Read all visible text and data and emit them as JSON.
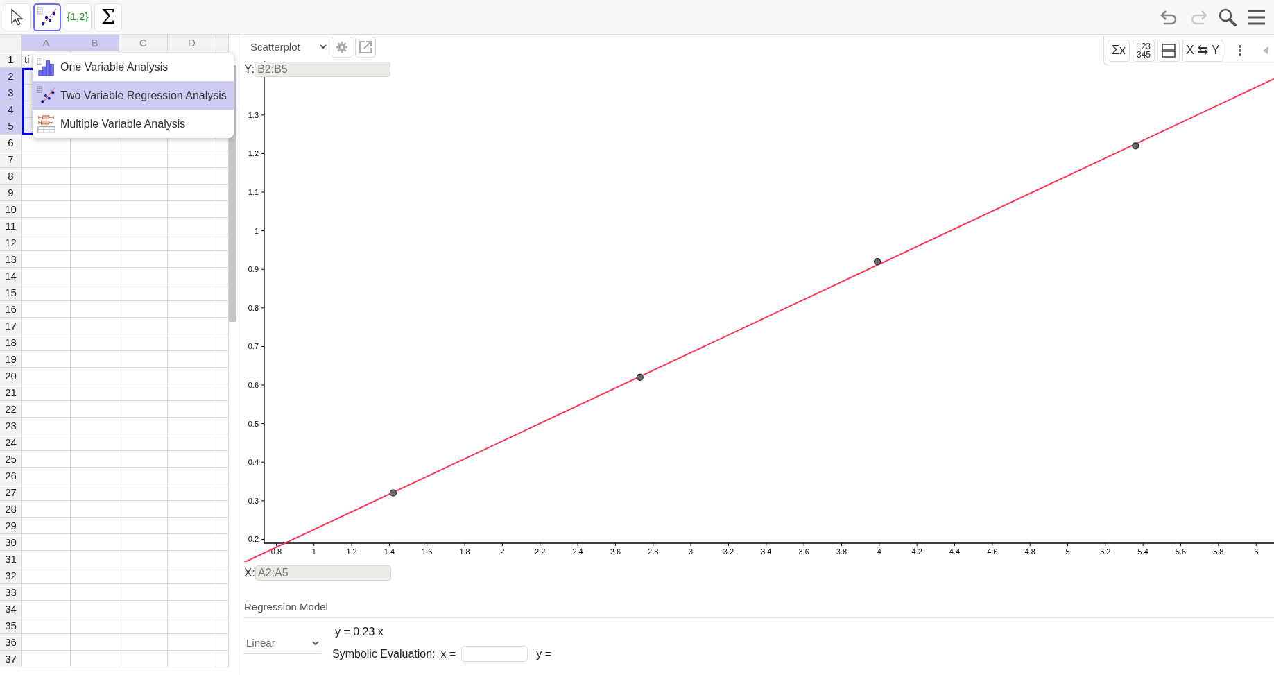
{
  "toolbar": {
    "tools": [
      {
        "kind": "pointer",
        "selected": false
      },
      {
        "kind": "regression",
        "selected": true
      },
      {
        "kind": "list",
        "label": "{1,2}",
        "selected": false
      },
      {
        "kind": "sum",
        "label": "Σ",
        "selected": false
      }
    ],
    "actions": [
      {
        "kind": "undo",
        "disabled": false
      },
      {
        "kind": "redo",
        "disabled": true
      },
      {
        "kind": "search"
      },
      {
        "kind": "menu"
      }
    ]
  },
  "spreadsheet": {
    "columns": [
      {
        "label": "A",
        "selected": true
      },
      {
        "label": "B",
        "selected": true
      },
      {
        "label": "C",
        "selected": false
      },
      {
        "label": "D",
        "selected": false
      }
    ],
    "rows": [
      {
        "label": "1",
        "selected": false,
        "cells": [
          "ti"
        ]
      },
      {
        "label": "2",
        "selected": true
      },
      {
        "label": "3",
        "selected": true
      },
      {
        "label": "4",
        "selected": true
      },
      {
        "label": "5",
        "selected": true
      },
      {
        "label": "6",
        "selected": false
      },
      {
        "label": "7",
        "selected": false
      },
      {
        "label": "8",
        "selected": false
      },
      {
        "label": "9",
        "selected": false
      },
      {
        "label": "10",
        "selected": false
      },
      {
        "label": "11",
        "selected": false
      },
      {
        "label": "12",
        "selected": false
      },
      {
        "label": "13",
        "selected": false
      },
      {
        "label": "14",
        "selected": false
      },
      {
        "label": "15",
        "selected": false
      },
      {
        "label": "16",
        "selected": false
      },
      {
        "label": "17",
        "selected": false
      },
      {
        "label": "18",
        "selected": false
      },
      {
        "label": "19",
        "selected": false
      },
      {
        "label": "20",
        "selected": false
      },
      {
        "label": "21",
        "selected": false
      },
      {
        "label": "22",
        "selected": false
      },
      {
        "label": "23",
        "selected": false
      },
      {
        "label": "24",
        "selected": false
      },
      {
        "label": "25",
        "selected": false
      },
      {
        "label": "26",
        "selected": false
      },
      {
        "label": "27",
        "selected": false
      },
      {
        "label": "28",
        "selected": false
      },
      {
        "label": "29",
        "selected": false
      },
      {
        "label": "30",
        "selected": false
      },
      {
        "label": "31",
        "selected": false
      },
      {
        "label": "32",
        "selected": false
      },
      {
        "label": "33",
        "selected": false
      },
      {
        "label": "34",
        "selected": false
      },
      {
        "label": "35",
        "selected": false
      },
      {
        "label": "36",
        "selected": false
      },
      {
        "label": "37",
        "selected": false
      }
    ]
  },
  "analysis_menu": {
    "items": [
      {
        "kind": "one_variable",
        "label": "One Variable Analysis",
        "selected": false
      },
      {
        "kind": "two_variable",
        "label": "Two Variable Regression Analysis",
        "selected": true
      },
      {
        "kind": "multiple_variable",
        "label": "Multiple Variable Analysis",
        "selected": false
      }
    ]
  },
  "plot_panel": {
    "plot_type": "Scatterplot",
    "tools": [
      {
        "kind": "text",
        "label": "Σx"
      },
      {
        "kind": "stack",
        "lines": [
          "123",
          "345"
        ]
      },
      {
        "kind": "layout"
      },
      {
        "kind": "text",
        "label": "X ⇆ Y"
      },
      {
        "kind": "more"
      },
      {
        "kind": "collapse"
      }
    ],
    "y_label": "Y:",
    "y_field": "B2:B5",
    "x_label": "X:",
    "x_field": "A2:A5",
    "chart_data": {
      "type": "scatter",
      "x": [
        1.42,
        2.73,
        3.99,
        5.36
      ],
      "series": [
        {
          "color": "#6b6b6b",
          "values": [
            0.32,
            0.62,
            0.92,
            1.22
          ]
        }
      ],
      "xlim": [
        0.736,
        6.095
      ],
      "ylim": [
        0.19,
        1.44
      ],
      "xticks": [
        0.8,
        1,
        1.2,
        1.4,
        1.6,
        1.8,
        2,
        2.2,
        2.4,
        2.6,
        2.8,
        3,
        3.2,
        3.4,
        3.6,
        3.8,
        4,
        4.2,
        4.4,
        4.6,
        4.8,
        5,
        5.2,
        5.4,
        5.6,
        5.8,
        6
      ],
      "yticks": [
        0.2,
        0.3,
        0.4,
        0.5,
        0.6,
        0.7,
        0.8,
        0.9,
        1,
        1.1,
        1.2,
        1.3
      ]
    }
  },
  "regression": {
    "title": "Regression Model",
    "model": "Linear",
    "equation": "y = 0.23 x",
    "evaluation_label": "Symbolic Evaluation:",
    "x_label": "x =",
    "y_label": "y ="
  }
}
